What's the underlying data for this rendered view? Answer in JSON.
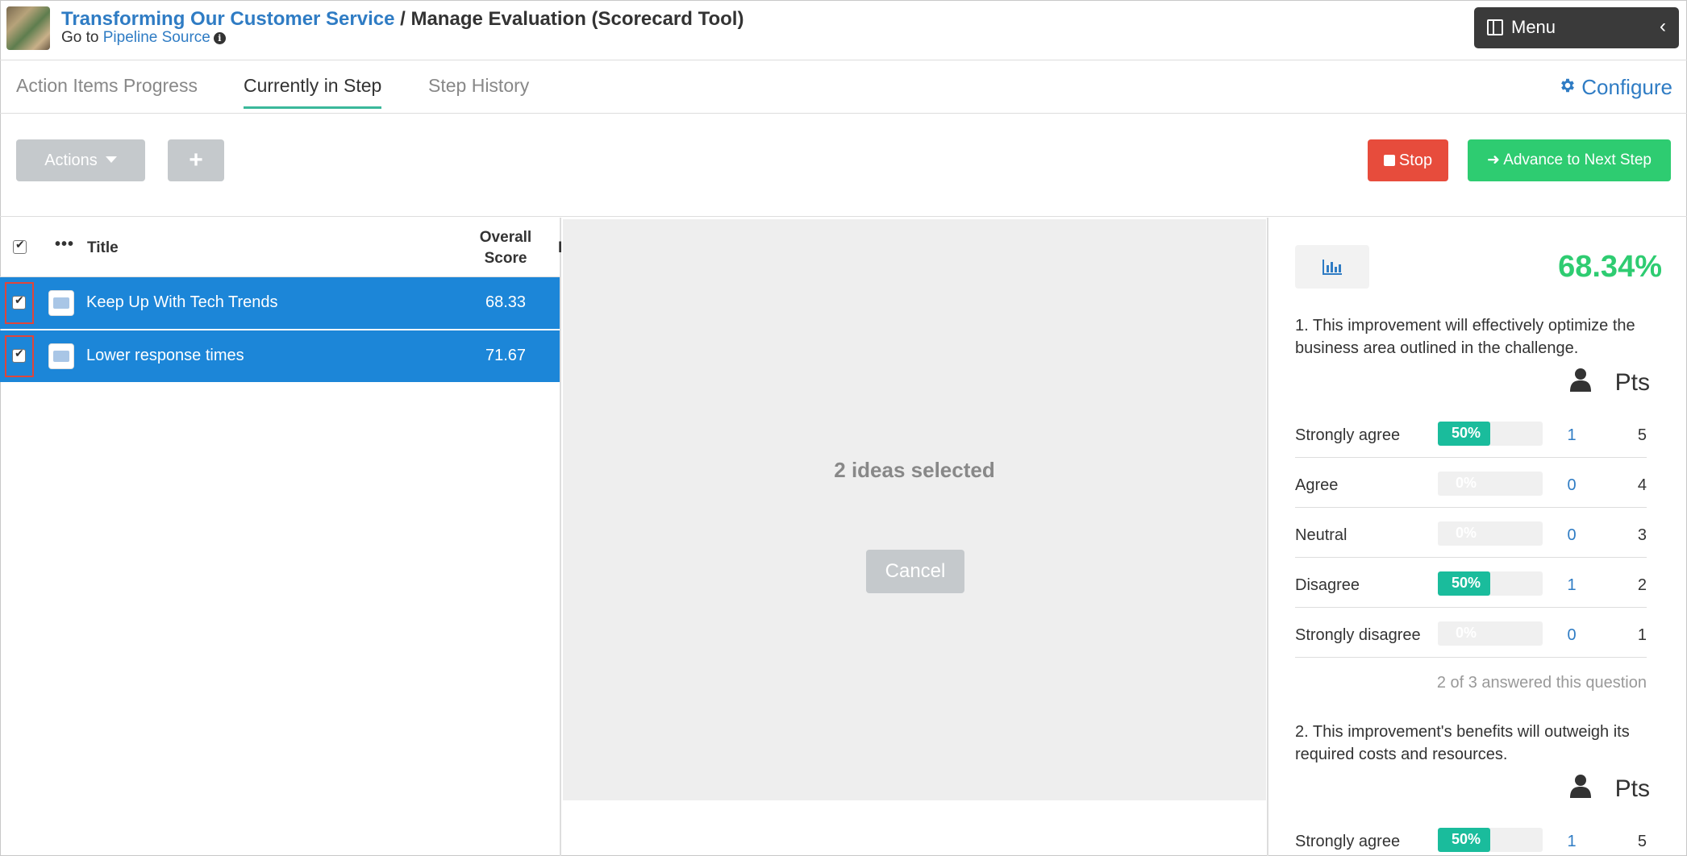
{
  "header": {
    "title_link": "Transforming Our Customer Service",
    "title_separator": " / ",
    "title_rest": "Manage Evaluation (Scorecard Tool)",
    "goto_prefix": "Go to ",
    "goto_link": "Pipeline Source",
    "menu_label": "Menu",
    "menu_chevron": "‹"
  },
  "tabs": [
    {
      "label": "Action Items Progress",
      "active": false
    },
    {
      "label": "Currently in Step",
      "active": true
    },
    {
      "label": "Step History",
      "active": false
    }
  ],
  "configure_label": "Configure",
  "toolbar": {
    "actions_label": "Actions",
    "add_label": "+",
    "stop_label": "Stop",
    "advance_label": "Advance to Next Step"
  },
  "list": {
    "columns": {
      "title": "Title",
      "score_line1": "Overall",
      "score_line2": "Score",
      "cut": "I"
    },
    "rows": [
      {
        "title": "Keep Up With Tech Trends",
        "score": "68.33",
        "checked": true
      },
      {
        "title": "Lower response times",
        "score": "71.67",
        "checked": true
      }
    ]
  },
  "selection": {
    "text": "2 ideas selected",
    "cancel_label": "Cancel"
  },
  "scorecard": {
    "overall_percent": "68.34%",
    "pts_label": "Pts",
    "questions": [
      {
        "text": "1. This improvement will effectively optimize the business area outlined in the challenge.",
        "options": [
          {
            "label": "Strongly agree",
            "percent_text": "50%",
            "fraction": 0.5,
            "count": "1",
            "pts": "5"
          },
          {
            "label": "Agree",
            "percent_text": "0%",
            "fraction": 0,
            "count": "0",
            "pts": "4"
          },
          {
            "label": "Neutral",
            "percent_text": "0%",
            "fraction": 0,
            "count": "0",
            "pts": "3"
          },
          {
            "label": "Disagree",
            "percent_text": "50%",
            "fraction": 0.5,
            "count": "1",
            "pts": "2"
          },
          {
            "label": "Strongly disagree",
            "percent_text": "0%",
            "fraction": 0,
            "count": "0",
            "pts": "1"
          }
        ],
        "answered": "2 of 3 answered this question"
      },
      {
        "text": "2. This improvement's benefits will outweigh its required costs and resources.",
        "options": [
          {
            "label": "Strongly agree",
            "percent_text": "50%",
            "fraction": 0.5,
            "count": "1",
            "pts": "5"
          }
        ]
      }
    ]
  },
  "colors": {
    "link": "#2f7cc4",
    "row_selected": "#1c86d8",
    "stop": "#e74c3c",
    "advance": "#2ecc71",
    "bar_fill": "#1abc9c",
    "tab_underline": "#3ab89a"
  }
}
